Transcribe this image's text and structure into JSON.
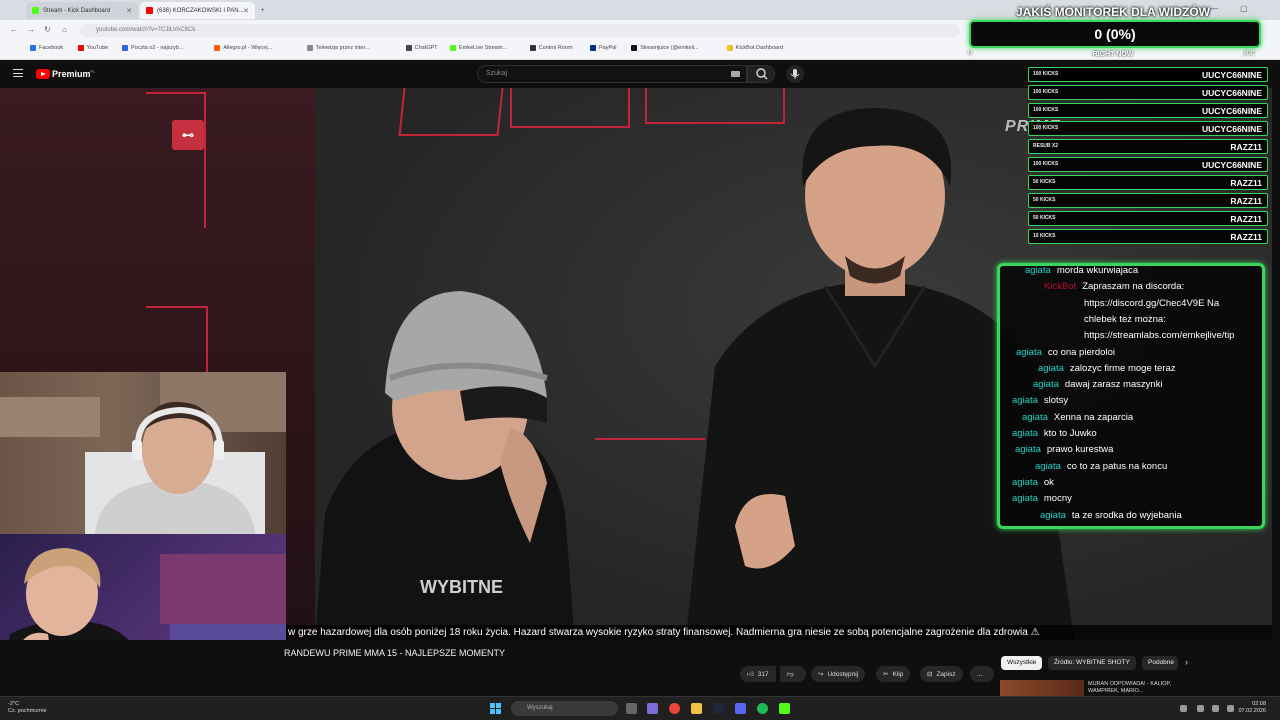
{
  "browser": {
    "tabs": [
      {
        "label": "Stream - Kick Dashboard",
        "color": "#53fc18"
      },
      {
        "label": "(636) KORCZAKOWSKI I PAN...",
        "color": "#ff0000"
      }
    ],
    "url": "youtube.com/watch?v=7CJILVAC8Ck",
    "bookmarks": [
      {
        "label": "Facebook",
        "color": "#1877f2"
      },
      {
        "label": "YouTube",
        "color": "#ff0000"
      },
      {
        "label": "Poczta o2 - najszyb...",
        "color": "#2a6ad8"
      },
      {
        "label": "Allegro.pl - Więcej...",
        "color": "#ff5a00"
      },
      {
        "label": "Telewizja przez inter...",
        "color": "#888888"
      },
      {
        "label": "ChatGPT",
        "color": "#444444"
      },
      {
        "label": "EmkeLive Stream...",
        "color": "#53fc18"
      },
      {
        "label": "Control Room",
        "color": "#333333"
      },
      {
        "label": "PayPal",
        "color": "#003087"
      },
      {
        "label": "Streamjuice (@emkeli...",
        "color": "#111111"
      },
      {
        "label": "KickBot Dashboard",
        "color": "#f0c419"
      }
    ]
  },
  "youtube": {
    "brand": "Premium",
    "brand_region": "PL",
    "search_placeholder": "Szukaj"
  },
  "video": {
    "subtitle": "w grze hazardowej dla osób poniżej 18 roku życia. Hazard stwarza wysokie ryzyko straty finansowej. Nadmierna gra niesie ze sobą potencjalne zagrożenie dla zdrowia ⚠",
    "title": "RANDEWU PRIME MMA 15 - NAJLEPSZE MOMENTY",
    "badge_text": "⊷",
    "watermark": "PRIME",
    "hoodie_text": "WYBITNE"
  },
  "actions": {
    "likes": "317",
    "share": "Udostępnij",
    "clip": "Klip",
    "save": "Zapisz",
    "more": "..."
  },
  "chips": {
    "all": "Wszystkie",
    "source": "Źródło: WYBITNE SHOTY",
    "similar": "Podobne"
  },
  "recommendation": {
    "title": "MURAN ODPOWIADA! - KALIOP, WAMPIREK, MARIO..."
  },
  "taskbar": {
    "temp": "-2°C",
    "weather": "Cz. pochmurnie",
    "search": "Wyszukaj",
    "time": "02:08",
    "date": "07.02.2026"
  },
  "monitor": {
    "title": "JAKIŚ MONITOREK DLA WIDZÓW",
    "value": "0 (0%)",
    "min": "0",
    "max": "100",
    "label": "RIGHT NOW",
    "level": 0
  },
  "donations": [
    {
      "amount": "100 KICKS",
      "user": "UUCYC66NINE"
    },
    {
      "amount": "100 KICKS",
      "user": "UUCYC66NINE"
    },
    {
      "amount": "100 KICKS",
      "user": "UUCYC66NINE"
    },
    {
      "amount": "100 KICKS",
      "user": "UUCYC66NINE"
    },
    {
      "amount": "RESUB X2",
      "user": "RAZZ11"
    },
    {
      "amount": "100 KICKS",
      "user": "UUCYC66NINE"
    },
    {
      "amount": "50 KICKS",
      "user": "RAZZ11"
    },
    {
      "amount": "50 KICKS",
      "user": "RAZZ11"
    },
    {
      "amount": "50 KICKS",
      "user": "RAZZ11"
    },
    {
      "amount": "10 KICKS",
      "user": "RAZZ11"
    }
  ],
  "chat": {
    "messages": [
      {
        "user": "agiata",
        "text": "morda wkurwiajaca"
      },
      {
        "user": "KickBot",
        "text": "Zapraszam na discorda:",
        "bot": true
      },
      {
        "user": "",
        "text": "https://discord.gg/Chec4V9E Na"
      },
      {
        "user": "",
        "text": "chlebek też można:"
      },
      {
        "user": "",
        "text": "https://streamlabs.com/emkejlive/tip"
      },
      {
        "user": "agiata",
        "text": "co ona pierdoloi"
      },
      {
        "user": "agiata",
        "text": "zalozyc firme moge teraz"
      },
      {
        "user": "agiata",
        "text": "dawaj zarasz maszynki"
      },
      {
        "user": "agiata",
        "text": "slotsy"
      },
      {
        "user": "agiata",
        "text": "Xenna na zaparcia"
      },
      {
        "user": "agiata",
        "text": "kto to Juwko"
      },
      {
        "user": "agiata",
        "text": "prawo kurestwa"
      },
      {
        "user": "agiata",
        "text": "co to za patus na koncu"
      },
      {
        "user": "agiata",
        "text": "ok"
      },
      {
        "user": "agiata",
        "text": "mocny"
      },
      {
        "user": "agiata",
        "text": "ta ze srodka do wyjebania"
      }
    ]
  },
  "colors": {
    "overlay_accent": "#37d85a",
    "chat_user": "#23d3c8",
    "bot_user": "#b0102a",
    "neon": "#c3243c"
  }
}
